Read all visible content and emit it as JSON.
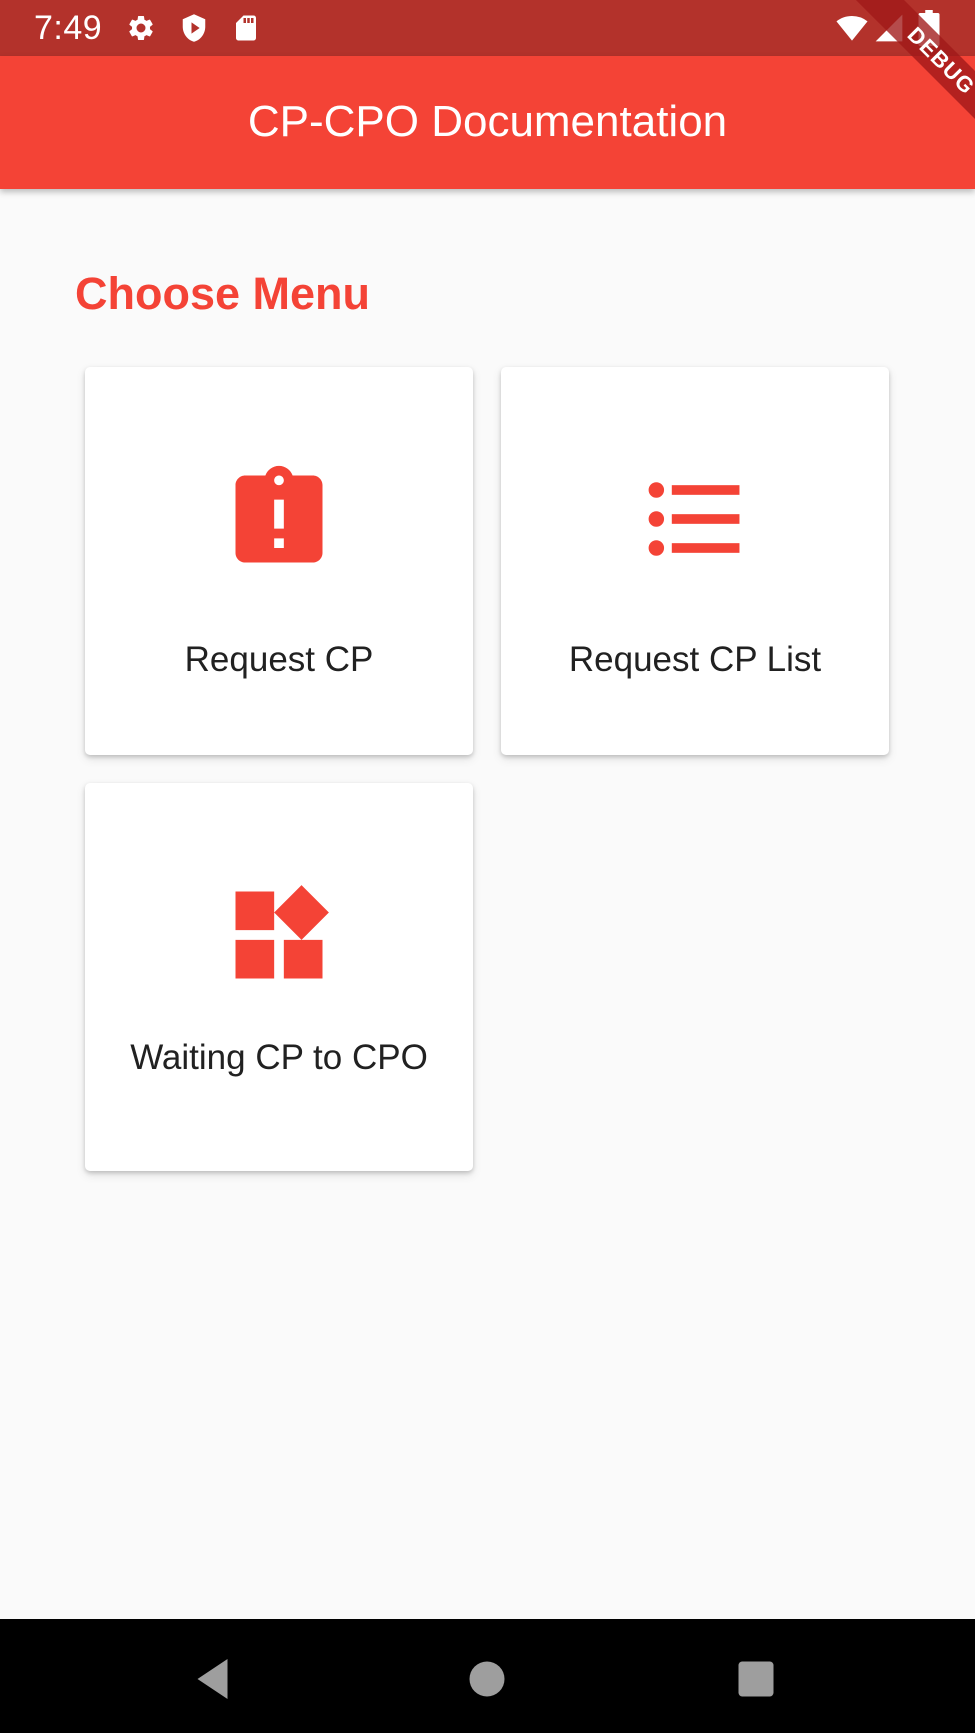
{
  "status_bar": {
    "time": "7:49",
    "icons": [
      "gear-icon",
      "shield-play-icon",
      "sd-card-icon",
      "wifi-icon",
      "signal-icon",
      "battery-icon"
    ]
  },
  "app_bar": {
    "title": "CP-CPO Documentation"
  },
  "debug_banner": "DEBUG",
  "content": {
    "heading": "Choose Menu",
    "menu_items": [
      {
        "label": "Request CP",
        "icon": "assignment-late-icon"
      },
      {
        "label": "Request CP List",
        "icon": "format-list-bulleted-icon"
      },
      {
        "label": "Waiting CP to CPO",
        "icon": "widgets-icon"
      }
    ]
  },
  "nav_bar": {
    "buttons": [
      "back-icon",
      "home-icon",
      "recents-icon"
    ]
  },
  "colors": {
    "primary": "#f44336",
    "status_bar": "#b3322b",
    "background": "#fafafa",
    "card": "#ffffff",
    "text": "#212121"
  }
}
